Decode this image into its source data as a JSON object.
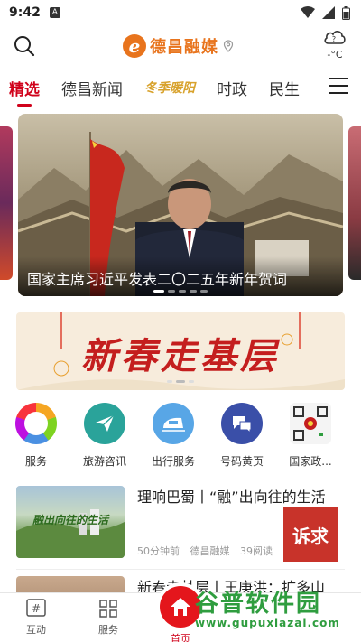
{
  "status_bar": {
    "time": "9:42",
    "badge": "A"
  },
  "header": {
    "logo_mark": "e",
    "logo_name": "德昌融媒",
    "weather_temp": "-°C",
    "weather_icon_glyph": "?"
  },
  "tabs": [
    {
      "label": "精选",
      "active": true
    },
    {
      "label": "德昌新闻"
    },
    {
      "label": "冬季暖阳"
    },
    {
      "label": "时政"
    },
    {
      "label": "民生"
    }
  ],
  "banner": {
    "caption": "国家主席习近平发表二〇二五年新年贺词"
  },
  "promo_banner": {
    "text": "新春走基层"
  },
  "services": [
    {
      "label": "服务",
      "icon": "rainbow-ring-icon",
      "color": "#f5a623"
    },
    {
      "label": "旅游咨讯",
      "icon": "paper-plane-icon",
      "color": "#2aa39a"
    },
    {
      "label": "出行服务",
      "icon": "train-icon",
      "color": "#58a6e6"
    },
    {
      "label": "号码黄页",
      "icon": "chat-bubbles-icon",
      "color": "#3a4fa8"
    },
    {
      "label": "国家政...",
      "icon": "qr-code-icon",
      "color": "#c41e1e"
    }
  ],
  "articles": [
    {
      "title": "理响巴蜀丨“融”出向往的生活",
      "time": "50分钟前",
      "source": "德昌融媒",
      "reads": "39阅读",
      "thumb_text": "融出向往的生活"
    },
    {
      "title": "新春走基层丨王庚洪：扩多山"
    }
  ],
  "complaint_label": "诉求",
  "bottom_nav": {
    "items": [
      {
        "label": "互动",
        "icon": "hash-icon"
      },
      {
        "label": "服务",
        "icon": "grid-icon"
      },
      {
        "label": "首页",
        "icon": "home-icon"
      }
    ]
  },
  "watermark": {
    "brand": "谷普软件园",
    "url": "www.gupuxlazal.com"
  },
  "colors": {
    "accent_red": "#d0021b",
    "brand_orange": "#e8741d",
    "special_gold": "#d8a22c"
  }
}
